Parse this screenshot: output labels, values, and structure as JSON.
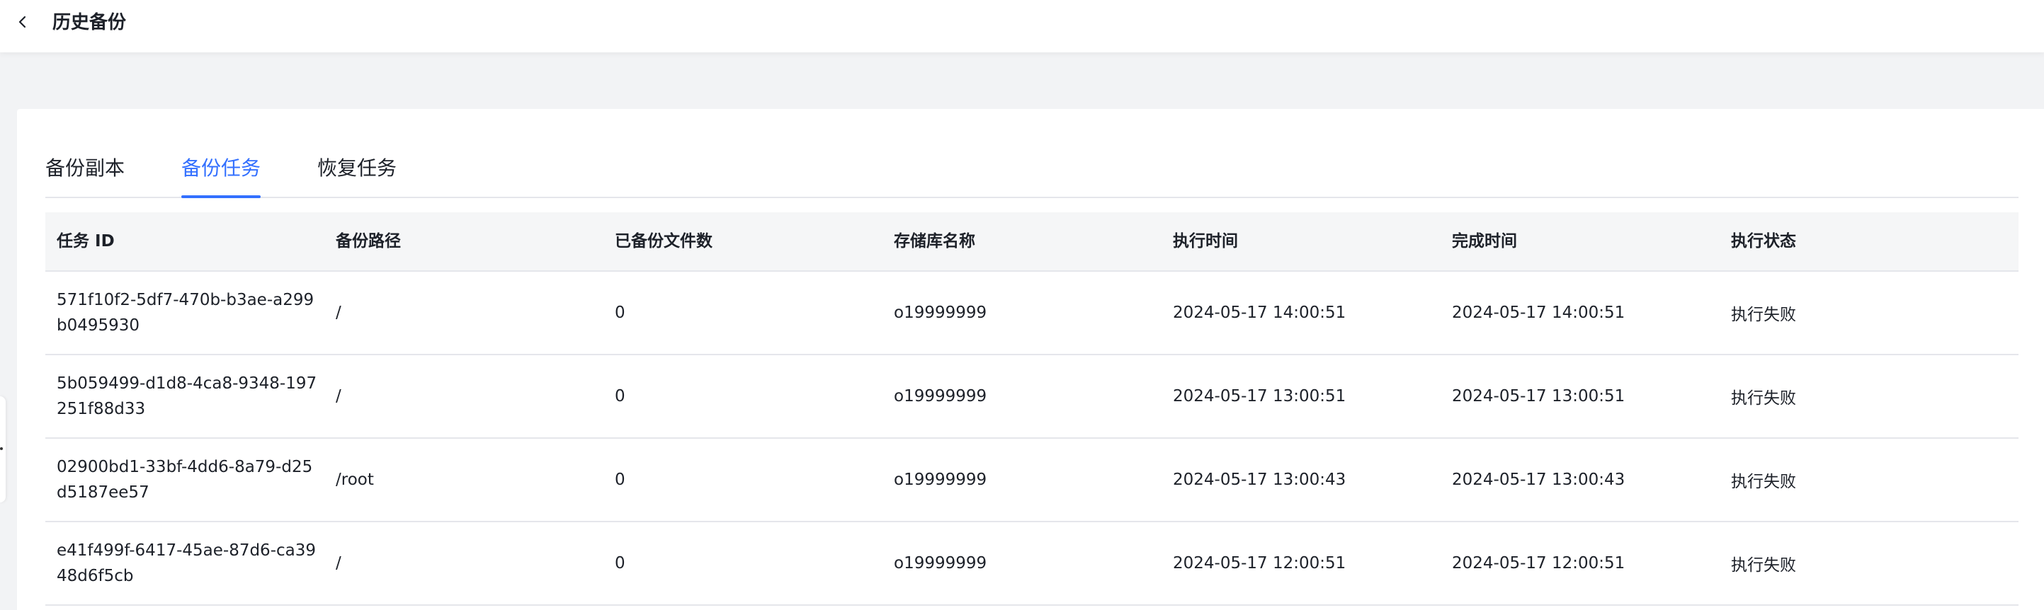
{
  "header": {
    "title": "历史备份",
    "back_icon": "chevron-left-icon"
  },
  "tabs": [
    {
      "label": "备份副本",
      "active": false
    },
    {
      "label": "备份任务",
      "active": true
    },
    {
      "label": "恢复任务",
      "active": false
    }
  ],
  "colors": {
    "accent": "#3370ff",
    "header_bg": "#f5f6f7",
    "page_bg": "#f2f3f5"
  },
  "table": {
    "columns": [
      "任务 ID",
      "备份路径",
      "已备份文件数",
      "存储库名称",
      "执行时间",
      "完成时间",
      "执行状态"
    ],
    "rows": [
      {
        "task_id": "571f10f2-5df7-470b-b3ae-a299b0495930",
        "path": "/",
        "files": "0",
        "repo": "o19999999",
        "start": "2024-05-17 14:00:51",
        "end": "2024-05-17 14:00:51",
        "status": "执行失败"
      },
      {
        "task_id": "5b059499-d1d8-4ca8-9348-197251f88d33",
        "path": "/",
        "files": "0",
        "repo": "o19999999",
        "start": "2024-05-17 13:00:51",
        "end": "2024-05-17 13:00:51",
        "status": "执行失败"
      },
      {
        "task_id": "02900bd1-33bf-4dd6-8a79-d25d5187ee57",
        "path": "/root",
        "files": "0",
        "repo": "o19999999",
        "start": "2024-05-17 13:00:43",
        "end": "2024-05-17 13:00:43",
        "status": "执行失败"
      },
      {
        "task_id": "e41f499f-6417-45ae-87d6-ca3948d6f5cb",
        "path": "/",
        "files": "0",
        "repo": "o19999999",
        "start": "2024-05-17 12:00:51",
        "end": "2024-05-17 12:00:51",
        "status": "执行失败"
      }
    ]
  }
}
